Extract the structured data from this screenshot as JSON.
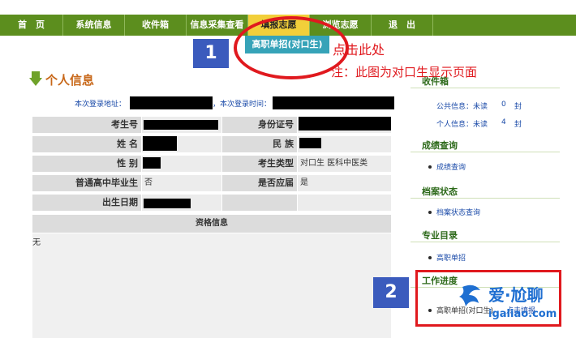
{
  "nav": {
    "items": [
      "首　页",
      "系统信息",
      "收件箱",
      "信息采集查看",
      "填报志愿",
      "浏览志愿",
      "退　出"
    ],
    "dropdown_item": "高职单招(对口生)"
  },
  "annotations": {
    "num1": "1",
    "num2": "2",
    "click_here": "点击此处",
    "note": "注：此图为对口生显示页面"
  },
  "personal": {
    "title": "个人信息",
    "login_address_label": "本次登录地址：",
    "login_time_label": "，本次登录时间："
  },
  "table": {
    "candidate_no": "考生号",
    "id_no": "身份证号",
    "name": "姓 名",
    "ethnicity": "民 族",
    "gender": "性 别",
    "exam_type": "考生类型",
    "exam_type_value": "对口生 医科中医类",
    "hs_grad": "普通高中毕业生",
    "hs_grad_value": "否",
    "fresh_grad": "是否应届",
    "fresh_grad_value": "是",
    "birthday": "出生日期",
    "qual_header": "资格信息",
    "qual_value": "无"
  },
  "sidebar": {
    "inbox_title": "收件箱",
    "public_info": "公共信息：未读",
    "public_count": "0",
    "public_unit": "封",
    "personal_info": "个人信息：未读",
    "personal_count": "4",
    "personal_unit": "封",
    "score_title": "成绩查询",
    "score_link": "成绩查询",
    "archive_title": "档案状态",
    "archive_link": "档案状态查询",
    "catalog_title": "专业目录",
    "catalog_link": "高职单招",
    "progress_title": "工作进度",
    "progress_item": "高职单招(对口生)",
    "progress_action": "点击填报"
  },
  "watermark": {
    "brand": "爱·尬聊",
    "url": "igaliao.com"
  },
  "colors": {
    "nav_bg": "#5c8e1e",
    "nav_active": "#f2cf3a",
    "annotation_red": "#e0191e",
    "number_box_blue": "#3b5bbd",
    "link_blue": "#1a4aa8"
  }
}
